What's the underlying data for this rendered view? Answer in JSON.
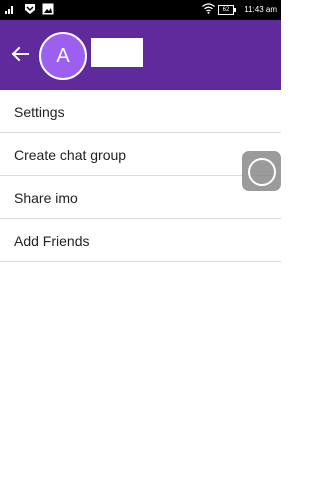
{
  "status_bar": {
    "time": "11:43 am",
    "battery_level": "62",
    "icons": [
      "signal-icon",
      "notification-icon",
      "image-icon",
      "wifi-icon",
      "battery-icon"
    ]
  },
  "toolbar": {
    "avatar_letter": "A",
    "background_color": "#5e2a9c",
    "avatar_color": "#9c5ff0"
  },
  "menu": {
    "items": [
      {
        "label": "Settings"
      },
      {
        "label": "Create chat group"
      },
      {
        "label": "Share imo"
      },
      {
        "label": "Add Friends"
      }
    ]
  }
}
